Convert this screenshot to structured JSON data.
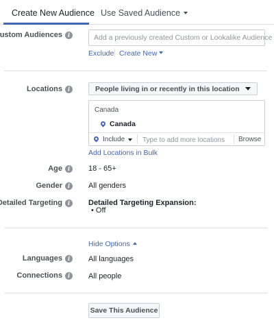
{
  "tabs": {
    "create_new": "Create New Audience",
    "use_saved": "Use Saved Audience"
  },
  "custom_audiences": {
    "label": "Custom Audiences",
    "placeholder": "Add a previously created Custom or Lookalike Audience",
    "exclude": "Exclude",
    "create_new": "Create New"
  },
  "locations": {
    "label": "Locations",
    "type_select": "People living in or recently in this location",
    "country_header": "Canada",
    "selected": "Canada",
    "include": "Include",
    "placeholder": "Type to add more locations",
    "browse": "Browse",
    "add_bulk": "Add Locations in Bulk"
  },
  "age": {
    "label": "Age",
    "value": "18 - 65+"
  },
  "gender": {
    "label": "Gender",
    "value": "All genders"
  },
  "detailed_targeting": {
    "label": "Detailed Targeting",
    "expansion_title": "Detailed Targeting Expansion:",
    "expansion_value": "Off"
  },
  "hide_options": "Hide Options",
  "languages": {
    "label": "Languages",
    "value": "All languages"
  },
  "connections": {
    "label": "Connections",
    "value": "All people"
  },
  "save_button": "Save This Audience",
  "colors": {
    "accent": "#4267b2",
    "text": "#1d2129",
    "label": "#4b4f56",
    "border": "#ccd0d5"
  }
}
